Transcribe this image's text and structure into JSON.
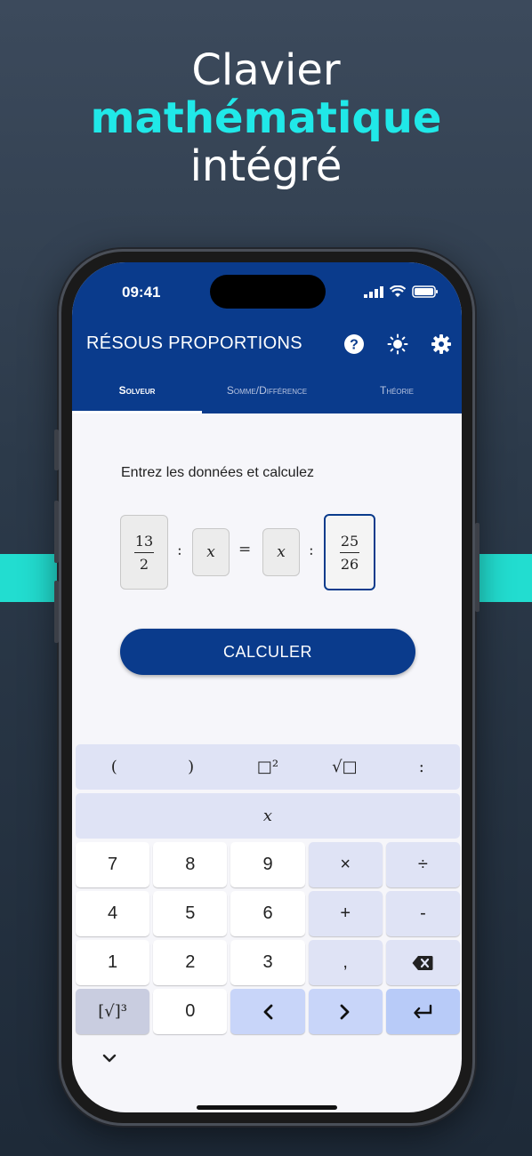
{
  "headline": {
    "line1": "Clavier",
    "line2": "mathématique",
    "line3": "intégré"
  },
  "status": {
    "time": "09:41"
  },
  "appbar": {
    "title": "RÉSOUS PROPORTIONS"
  },
  "tabs": [
    {
      "label": "Solveur"
    },
    {
      "label": "Somme/Différence"
    },
    {
      "label": "Théorie"
    }
  ],
  "main": {
    "prompt": "Entrez les données et calculez",
    "equation": {
      "a_num": "13",
      "a_den": "2",
      "b": "x",
      "c": "x",
      "d_num": "25",
      "d_den": "26",
      "ratio1": ":",
      "equals": "=",
      "ratio2": ":"
    },
    "calc_label": "CALCULER"
  },
  "keyboard": {
    "top": [
      "(",
      ")",
      "□²",
      "√□",
      ":"
    ],
    "var": "x",
    "row1": [
      "7",
      "8",
      "9",
      "×",
      "÷"
    ],
    "row2": [
      "4",
      "5",
      "6",
      "+",
      "-"
    ],
    "row3": [
      "1",
      "2",
      "3",
      ","
    ],
    "row4": [
      "[√]³",
      "0"
    ]
  },
  "colors": {
    "accent": "#0a3b8c",
    "highlight": "#20e8e8",
    "band": "#22ddd0"
  },
  "icons": [
    "help-icon",
    "brightness-icon",
    "settings-icon",
    "backspace-icon",
    "chevron-left-icon",
    "chevron-right-icon",
    "enter-icon",
    "chevron-down-icon"
  ]
}
